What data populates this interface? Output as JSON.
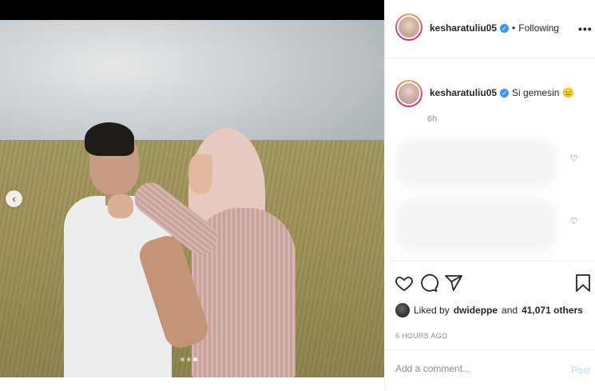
{
  "post": {
    "username": "kesharatuliu05",
    "follow_status": "Following",
    "more_label": "•••",
    "verified_mark": "✓"
  },
  "caption": {
    "username": "kesharatuliu05",
    "text": "Si gemesin",
    "emoji": "😑",
    "age": "6h"
  },
  "comment_hearts": [
    "♡",
    "♡"
  ],
  "media": {
    "prev_arrow": "‹",
    "carousel_dots": 3,
    "active_dot": 3
  },
  "icons": {
    "like": "heart-icon",
    "comment": "comment-icon",
    "share": "share-icon",
    "save": "bookmark-icon"
  },
  "likes": {
    "prefix": "Liked by",
    "user": "dwideppe",
    "connector": "and",
    "count": "41,071 others"
  },
  "timestamp": "6 HOURS AGO",
  "comment_box": {
    "placeholder": "Add a comment...",
    "post_label": "Post"
  },
  "colors": {
    "verified": "#3897f0",
    "post_disabled": "#b2dffc",
    "muted_text": "#8e8e8e"
  }
}
